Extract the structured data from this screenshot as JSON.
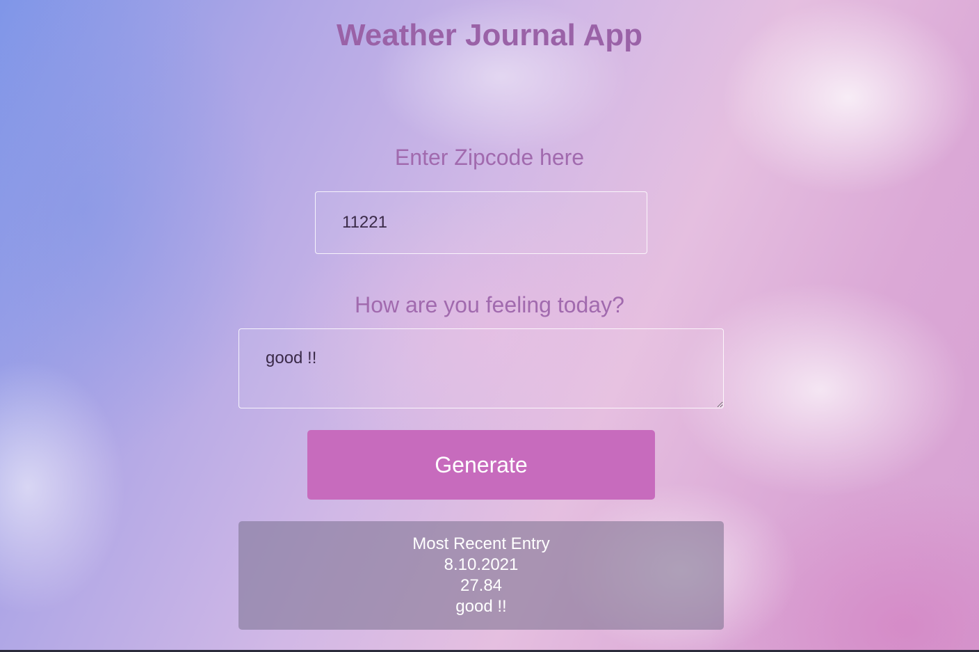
{
  "app": {
    "title": "Weather Journal App"
  },
  "zip": {
    "label": "Enter Zipcode here",
    "value": "11221"
  },
  "feelings": {
    "label": "How are you feeling today?",
    "value": "good !!"
  },
  "generate": {
    "label": "Generate"
  },
  "entry": {
    "heading": "Most Recent Entry",
    "date": "8.10.2021",
    "temp": "27.84",
    "content": "good !!"
  },
  "colors": {
    "accent": "#c76bbd",
    "heading": "#9a62a7"
  }
}
